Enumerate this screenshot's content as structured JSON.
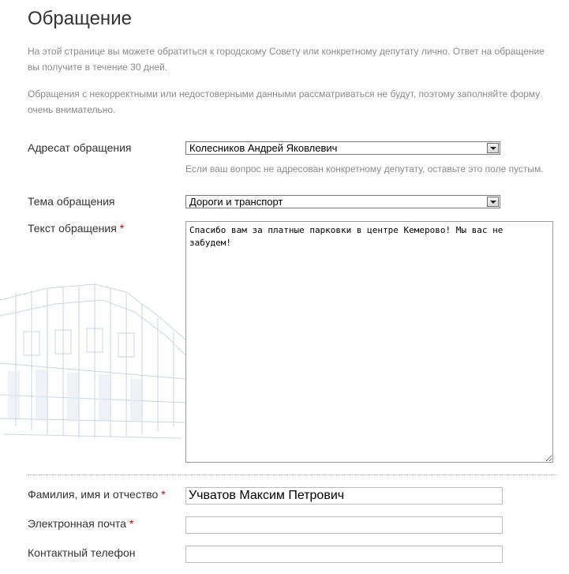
{
  "page": {
    "title": "Обращение",
    "intro_1": "На этой странице вы можете обратиться к городскому Совету или конкретному депутату лично. Ответ на обращение вы получите в течение 30 дней.",
    "intro_2": "Обращения с некорректными или недостоверными данными рассматриваться не будут, поэтому заполняйте форму очень внимательно."
  },
  "form": {
    "required_mark": "*",
    "addressee": {
      "label": "Адресат обращения",
      "value": "Колесников Андрей Яковлевич",
      "hint": "Если ваш вопрос не адресован конкретному депутату, оставьте это поле пустым."
    },
    "topic": {
      "label": "Тема обращения",
      "value": "Дороги и транспорт"
    },
    "text": {
      "label": "Текст обращения",
      "value": "Спасибо вам за платные парковки в центре Кемерово! Мы вас не забудем!"
    },
    "full_name": {
      "label": "Фамилия, имя и отчество",
      "value": "Учватов Максим Петрович"
    },
    "email": {
      "label": "Электронная почта",
      "value": ""
    },
    "phone": {
      "label": "Контактный телефон",
      "value": ""
    }
  }
}
